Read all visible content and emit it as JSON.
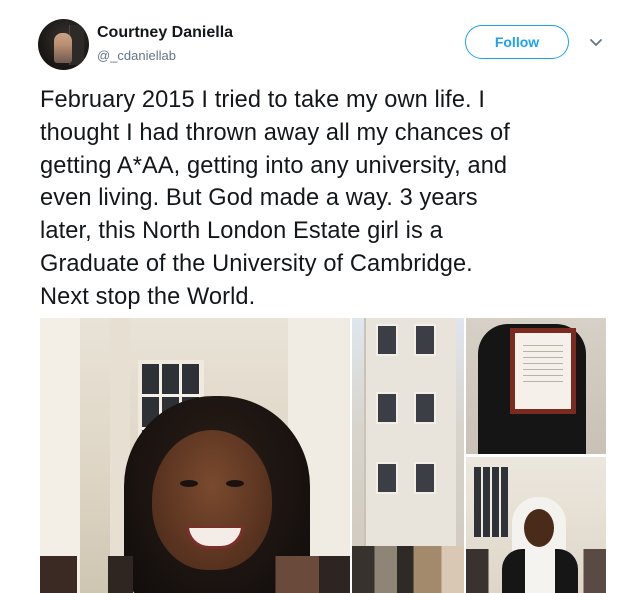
{
  "user": {
    "display_name": "Courtney Daniella",
    "handle": "@_cdaniellab"
  },
  "actions": {
    "follow_label": "Follow"
  },
  "tweet": {
    "text": "February 2015 I tried to take my own life. I\nthought I had thrown away all my chances of\ngetting A*AA, getting into any university, and\neven living. But God made a way. 3 years\nlater, this North London Estate girl is a\nGraduate of the University of Cambridge.\nNext stop the World."
  },
  "colors": {
    "accent": "#1da1f2",
    "text": "#14171a",
    "secondary_text": "#657786"
  },
  "icons": {
    "more_menu": "chevron-down-icon"
  }
}
